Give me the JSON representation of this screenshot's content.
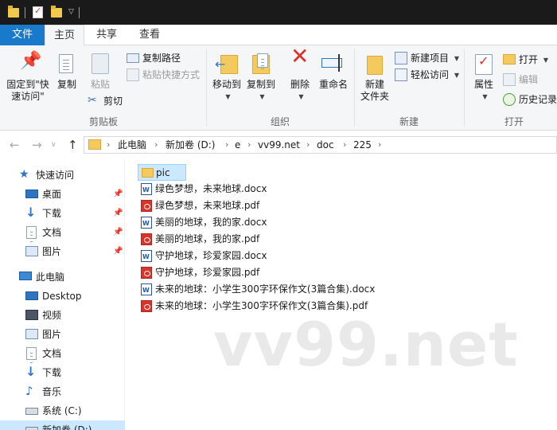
{
  "ribbon_tabs": {
    "file": "文件",
    "home": "主页",
    "share": "共享",
    "view": "查看"
  },
  "clipboard": {
    "pin_line1": "固定到\"快",
    "pin_line2": "速访问\"",
    "copy": "复制",
    "paste": "粘贴",
    "copy_path": "复制路径",
    "paste_shortcut": "粘贴快捷方式",
    "cut": "剪切",
    "label": "剪贴板"
  },
  "organize": {
    "move_to": "移动到",
    "copy_to": "复制到",
    "delete": "删除",
    "rename": "重命名",
    "label": "组织"
  },
  "new": {
    "new_folder_line1": "新建",
    "new_folder_line2": "文件夹",
    "new_item": "新建项目",
    "easy_access": "轻松访问",
    "label": "新建"
  },
  "open": {
    "properties": "属性",
    "open": "打开",
    "edit": "编辑",
    "history": "历史记录",
    "label": "打开"
  },
  "address": {
    "crumbs": [
      "此电脑",
      "新加卷 (D:)",
      "e",
      "vv99.net",
      "doc",
      "225"
    ]
  },
  "nav": {
    "quick_access": "快速访问",
    "quick_items": [
      "桌面",
      "下载",
      "文档",
      "图片"
    ],
    "this_pc": "此电脑",
    "pc_items": [
      "Desktop",
      "视频",
      "图片",
      "文档",
      "下载",
      "音乐",
      "系统 (C:)",
      "新加卷 (D:)"
    ]
  },
  "files": [
    {
      "name": "pic",
      "type": "folder"
    },
    {
      "name": "绿色梦想，未来地球.docx",
      "type": "docx"
    },
    {
      "name": "绿色梦想，未来地球.pdf",
      "type": "pdf"
    },
    {
      "name": "美丽的地球，我的家.docx",
      "type": "docx"
    },
    {
      "name": "美丽的地球，我的家.pdf",
      "type": "pdf"
    },
    {
      "name": "守护地球，珍爱家园.docx",
      "type": "docx"
    },
    {
      "name": "守护地球，珍爱家园.pdf",
      "type": "pdf"
    },
    {
      "name": "未来的地球：小学生300字环保作文(3篇合集).docx",
      "type": "docx"
    },
    {
      "name": "未来的地球：小学生300字环保作文(3篇合集).pdf",
      "type": "pdf"
    }
  ],
  "watermark": "vv99.net",
  "colors": {
    "accent": "#1979ca",
    "selection": "#cce8ff",
    "titlebar": "#1a1a1a"
  }
}
